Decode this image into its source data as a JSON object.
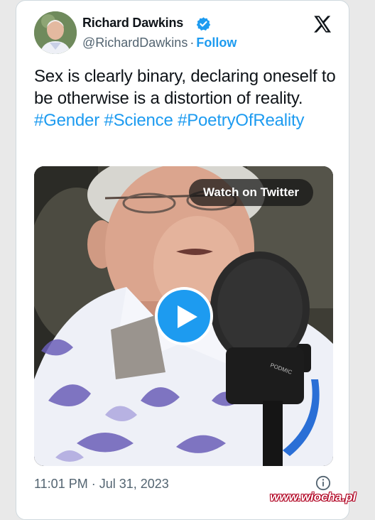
{
  "tweet": {
    "author_name": "Richard Dawkins",
    "handle": "@RichardDawkins",
    "separator": "·",
    "follow_label": "Follow",
    "text_plain": "Sex is clearly binary, declaring oneself to be otherwise is a distortion of reality.",
    "hashtags": [
      "#Gender",
      "#Science",
      "#PoetryOfReality"
    ],
    "media": {
      "watch_label": "Watch on Twitter",
      "mic_brand": "PODMIC"
    },
    "timestamp": "11:01 PM · Jul 31, 2023"
  },
  "watermark": "www.wiocha.pl",
  "colors": {
    "accent": "#1d9bf0",
    "text": "#0f1419",
    "secondary": "#536471"
  },
  "icons": {
    "verified": "verified-badge-icon",
    "brand": "x-logo-icon",
    "play": "play-icon",
    "info": "info-icon"
  }
}
